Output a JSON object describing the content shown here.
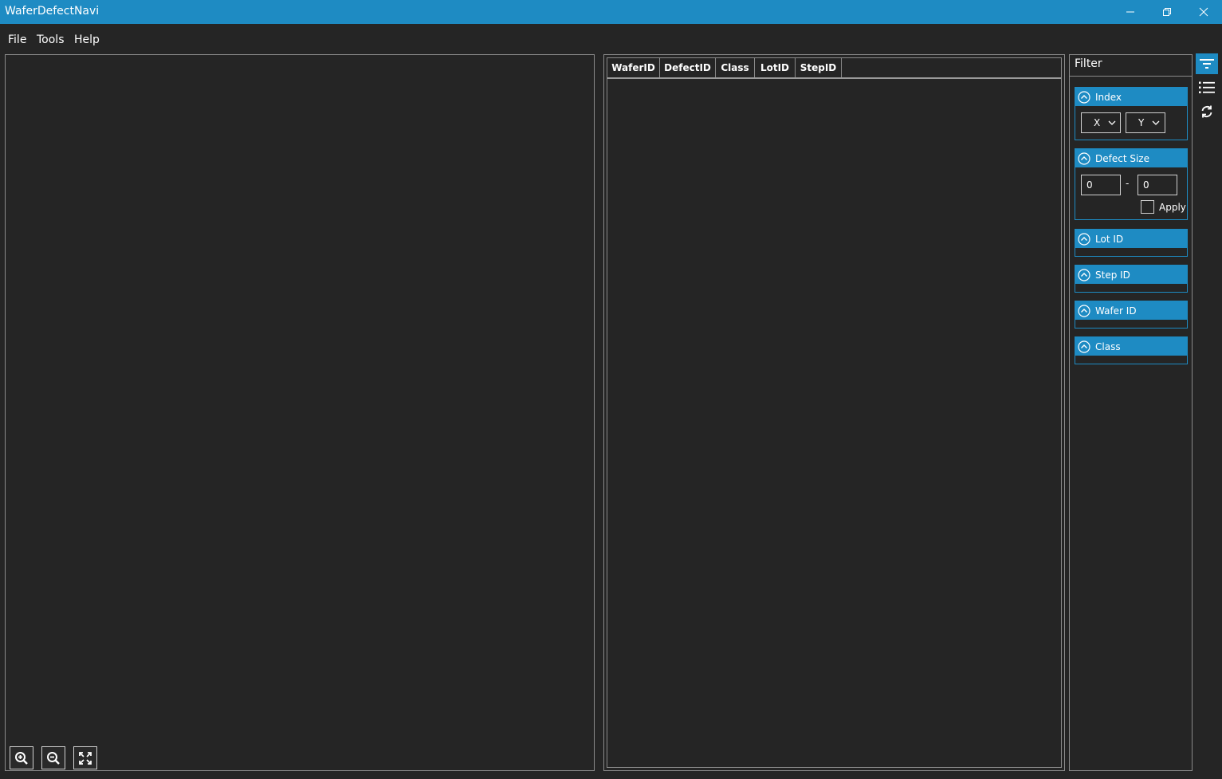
{
  "window": {
    "title": "WaferDefectNavi",
    "controls": [
      "minimize-icon",
      "restore-icon",
      "close-icon"
    ]
  },
  "menu": {
    "items": [
      "File",
      "Tools",
      "Help"
    ]
  },
  "map_toolbar": {
    "icons": [
      "zoom-in-icon",
      "zoom-out-icon",
      "fit-screen-icon"
    ]
  },
  "defect_table": {
    "columns": [
      "WaferID",
      "DefectID",
      "Class",
      "LotID",
      "StepID"
    ],
    "rows": []
  },
  "filter": {
    "title": "Filter",
    "index": {
      "label": "Index",
      "x_value": "X",
      "y_value": "Y"
    },
    "defect_size": {
      "label": "Defect Size",
      "min": "0",
      "separator": "-",
      "max": "0",
      "apply_label": "Apply",
      "apply_checked": false
    },
    "lot_id": {
      "label": "Lot ID"
    },
    "step_id": {
      "label": "Step ID"
    },
    "wafer_id": {
      "label": "Wafer ID"
    },
    "class": {
      "label": "Class"
    }
  },
  "side_toolbar": {
    "icons": [
      "filter-icon",
      "list-icon",
      "refresh-icon"
    ],
    "active": "filter-icon"
  },
  "colors": {
    "accent": "#1e8bc3",
    "background": "#252525",
    "border": "#8a8a8a",
    "text": "#ffffff"
  }
}
